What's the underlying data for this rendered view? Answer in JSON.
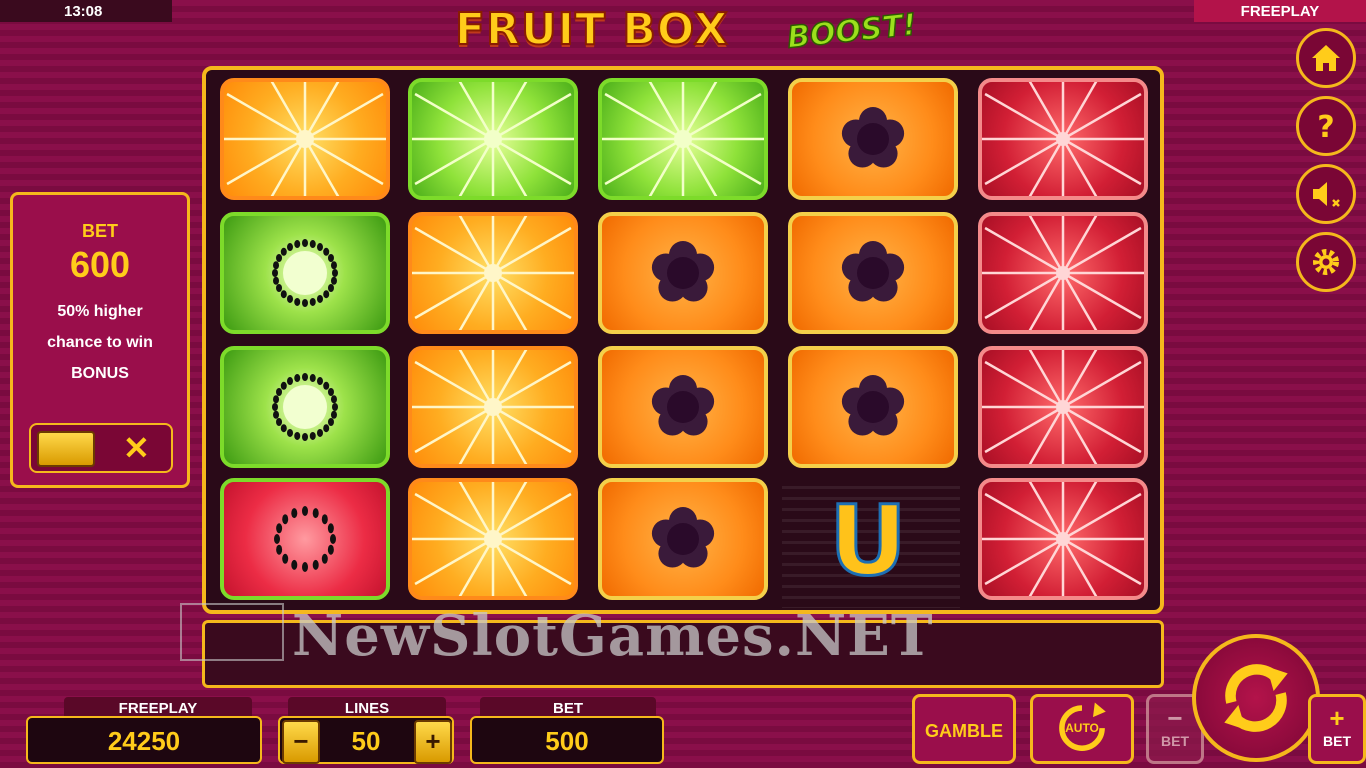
{
  "status_bar": {
    "time": "13:08",
    "mode": "FREEPLAY"
  },
  "logo": {
    "main": "FRUIT BOX",
    "sub": "BOOST!"
  },
  "bet_panel": {
    "label": "BET",
    "value": "600",
    "line1": "50% higher",
    "line2": "chance to win",
    "line3": "BONUS",
    "toggle_off_symbol": "✕"
  },
  "reels": [
    [
      "orange",
      "kiwi",
      "kiwi",
      "watermelon"
    ],
    [
      "lime",
      "orange",
      "orange",
      "orange"
    ],
    [
      "lime",
      "papaya",
      "papaya",
      "papaya"
    ],
    [
      "papaya",
      "papaya",
      "papaya",
      "u-bonus"
    ],
    [
      "pomegranate",
      "pomegranate",
      "pomegranate",
      "pomegranate"
    ]
  ],
  "u_symbol_letter": "U",
  "watermark": "NewSlotGames.NET",
  "bottom": {
    "freeplay_label": "FREEPLAY",
    "freeplay_value": "24250",
    "lines_label": "LINES",
    "lines_value": "50",
    "lines_minus": "−",
    "lines_plus": "+",
    "bet_label": "BET",
    "bet_value": "500",
    "gamble_label": "GAMBLE",
    "auto_label": "AUTO",
    "bet_minus_sign": "−",
    "bet_minus_label": "BET",
    "bet_plus_sign": "+",
    "bet_plus_label": "BET"
  },
  "side_buttons": [
    "home-icon",
    "help-icon",
    "sound-muted-icon",
    "settings-gear-icon"
  ],
  "colors": {
    "accent": "#f5b81c",
    "background": "#8a0f4a",
    "text_gold": "#ffcc1a"
  }
}
